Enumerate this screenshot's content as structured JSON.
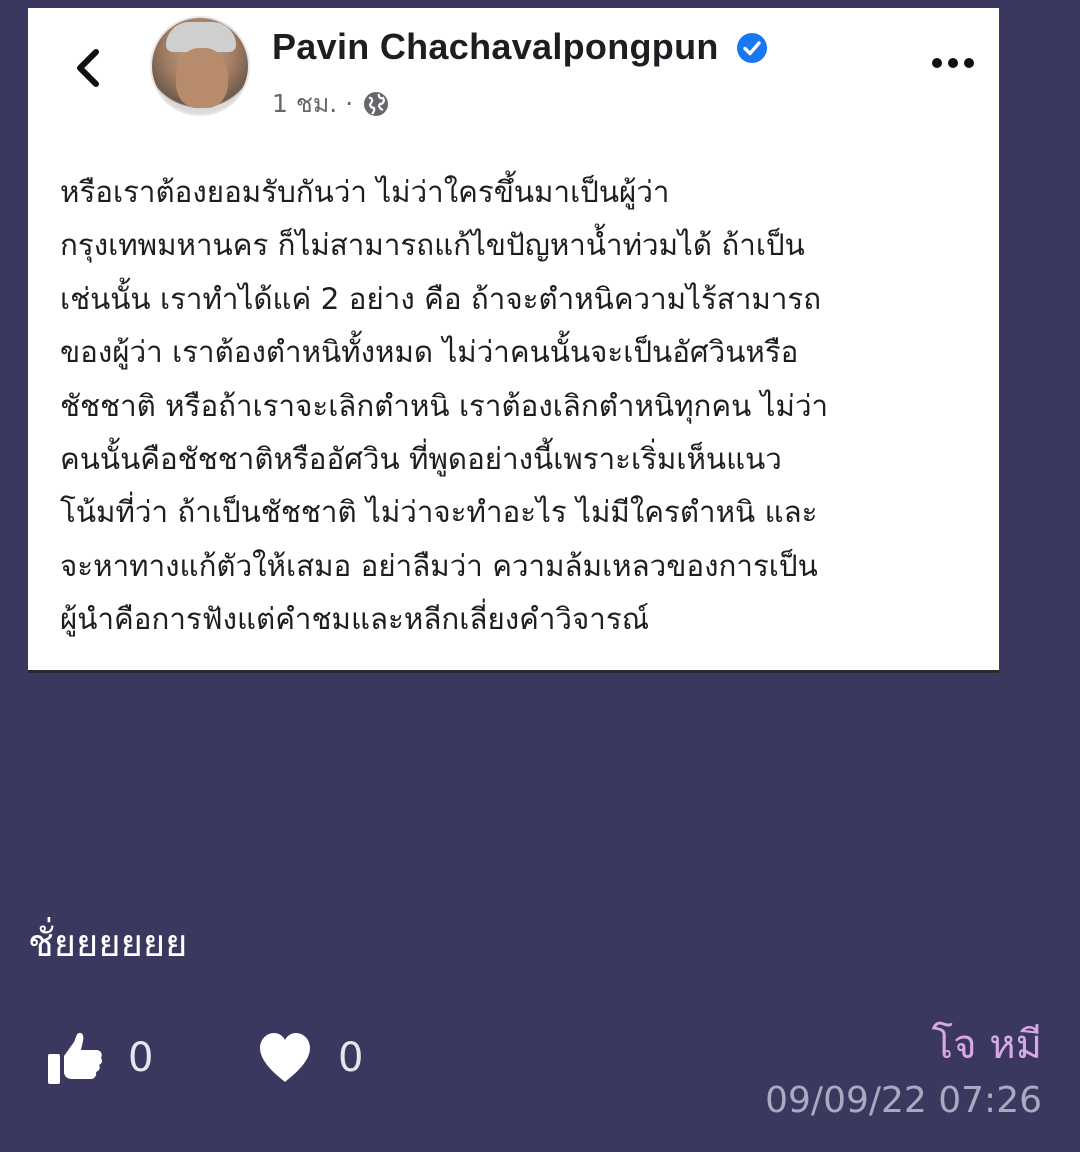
{
  "shared_post": {
    "author_name": "Pavin Chachavalpongpun",
    "timestamp": "1 ชม. ·",
    "body_lines": [
      "หรือเราต้องยอมรับกันว่า ไม่ว่าใครขึ้นมาเป็นผู้ว่า",
      "กรุงเทพมหานคร ก็ไม่สามารถแก้ไขปัญหาน้ำท่วมได้ ถ้าเป็น",
      "เช่นนั้น เราทำได้แค่ 2 อย่าง คือ ถ้าจะตำหนิความไร้สามารถ",
      "ของผู้ว่า เราต้องตำหนิทั้งหมด ไม่ว่าคนนั้นจะเป็นอัศวินหรือ",
      "ชัชชาติ หรือถ้าเราจะเลิกตำหนิ เราต้องเลิกตำหนิทุกคน ไม่ว่า",
      "คนนั้นคือชัชชาติหรืออัศวิน ที่พูดอย่างนี้เพราะเริ่มเห็นแนว",
      "โน้มที่ว่า ถ้าเป็นชัชชาติ ไม่ว่าจะทำอะไร ไม่มีใครตำหนิ และ",
      "จะหาทางแก้ตัวให้เสมอ อย่าลืมว่า ความล้มเหลวของการเป็น",
      "ผู้นำคือการฟังแต่คำชมและหลีกเลี่ยงคำวิจารณ์"
    ],
    "icons": {
      "back": "chevron-left-icon",
      "verified": "verified-badge-icon",
      "audience": "globe-icon",
      "more": "more-options-icon"
    }
  },
  "message": {
    "text": "ชั่ยยยยยย",
    "like_count": "0",
    "love_count": "0",
    "sender": "โจ หมี",
    "datetime": "09/09/22 07:26"
  },
  "colors": {
    "background": "#3b3860",
    "card": "#ffffff",
    "verified": "#1877f2",
    "sender": "#d7a7e6",
    "timestamp": "#a9a9bf"
  }
}
